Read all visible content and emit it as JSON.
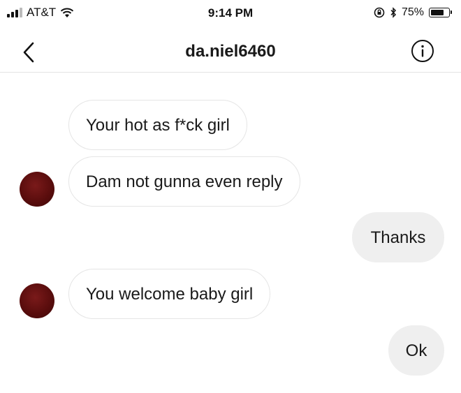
{
  "status_bar": {
    "carrier": "AT&T",
    "time": "9:14 PM",
    "battery_percent": "75%",
    "battery_level": 0.75
  },
  "nav": {
    "title": "da.niel6460",
    "back_icon": "chevron-left-icon",
    "info_icon": "info-circle-icon"
  },
  "messages": [
    {
      "sender": "other",
      "text": "Your hot as f*ck girl"
    },
    {
      "sender": "other",
      "text": "Dam not gunna even reply"
    },
    {
      "sender": "me",
      "text": "Thanks"
    },
    {
      "sender": "other",
      "text": "You welcome baby girl"
    },
    {
      "sender": "me",
      "text": "Ok"
    }
  ],
  "colors": {
    "outgoing_bubble": "#efefef",
    "incoming_border": "#e5e5e5",
    "avatar": "#5a0d0d"
  }
}
